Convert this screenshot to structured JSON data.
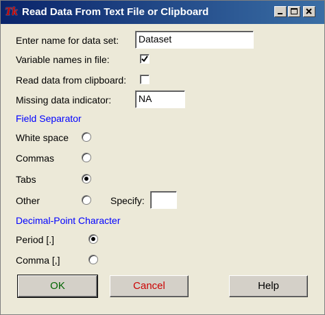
{
  "window": {
    "title": "Read Data From Text File or Clipboard",
    "logo_text": "Tk",
    "controls": [
      "minimize-icon",
      "maximize-icon",
      "close-icon"
    ]
  },
  "form": {
    "name_label": "Enter name for data set:",
    "name_value": "Dataset",
    "varnames_label": "Variable names in file:",
    "varnames_checked": true,
    "clipboard_label": "Read data from clipboard:",
    "clipboard_checked": false,
    "missing_label": "Missing data indicator:",
    "missing_value": "NA"
  },
  "field_separator": {
    "heading": "Field Separator",
    "options": [
      {
        "label": "White space",
        "selected": false
      },
      {
        "label": "Commas",
        "selected": false
      },
      {
        "label": "Tabs",
        "selected": true
      },
      {
        "label": "Other",
        "selected": false
      }
    ],
    "specify_label": "Specify:",
    "specify_value": ""
  },
  "decimal_point": {
    "heading": "Decimal-Point Character",
    "options": [
      {
        "label": "Period [.]",
        "selected": true
      },
      {
        "label": "Comma [,]",
        "selected": false
      }
    ]
  },
  "buttons": {
    "ok": "OK",
    "cancel": "Cancel",
    "help": "Help"
  },
  "colors": {
    "title_bar": "#0a246a",
    "ok_text": "#006400",
    "cancel_text": "#cc0000",
    "section_heading": "#0000ff"
  }
}
